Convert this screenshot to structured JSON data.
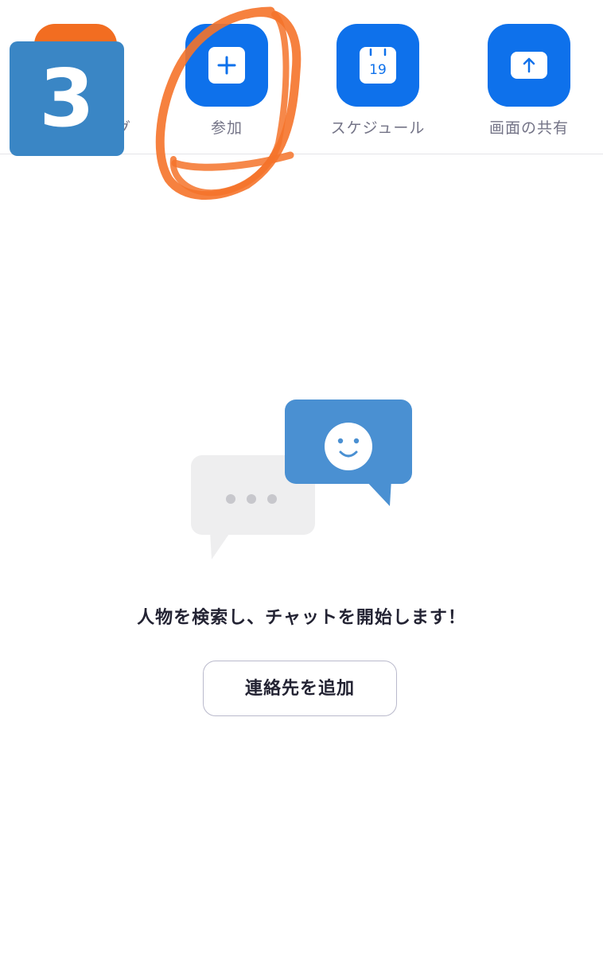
{
  "toolbar": {
    "items": [
      {
        "label": "グ",
        "icon": "meeting-icon"
      },
      {
        "label": "参加",
        "icon": "plus-icon"
      },
      {
        "label": "スケジュール",
        "icon": "calendar-icon",
        "calendar_day": "19"
      },
      {
        "label": "画面の共有",
        "icon": "share-up-arrow-icon"
      }
    ]
  },
  "step_badge": "3",
  "empty_state": {
    "message": "人物を検索し、チャットを開始します！",
    "add_contact_label": "連絡先を追加"
  },
  "colors": {
    "accent_blue": "#0e71eb",
    "new_meeting_orange": "#f26d21",
    "annotation_orange": "#f5732a",
    "badge_blue": "#3a86c5"
  }
}
